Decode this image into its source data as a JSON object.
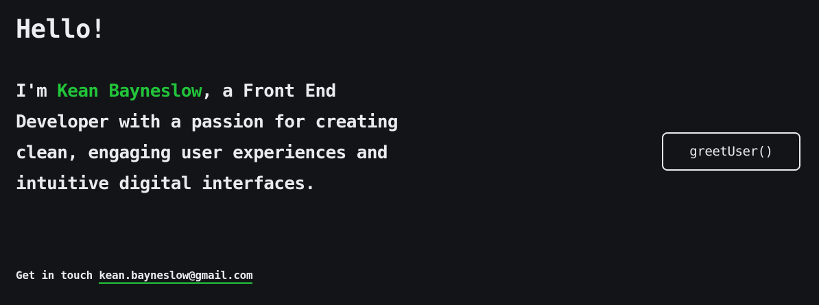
{
  "hero": {
    "greeting": "Hello!",
    "intro_prefix": "I'm ",
    "name": "Kean Bayneslow",
    "intro_suffix": ", a Front End Developer with a passion for creating clean, engaging user experiences and intuitive digital interfaces."
  },
  "contact": {
    "label": "Get in touch ",
    "email": "kean.bayneslow@gmail.com"
  },
  "actions": {
    "greet_label": "greetUser()"
  },
  "colors": {
    "background": "#121417",
    "text": "#e9ebee",
    "accent": "#22c43a"
  }
}
